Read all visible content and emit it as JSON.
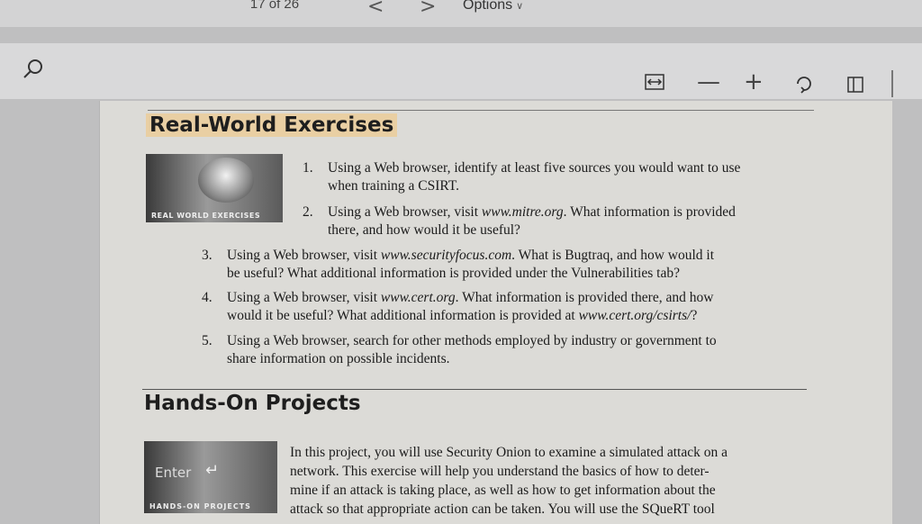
{
  "topbar": {
    "page_count": "17 of 26",
    "prev_glyph": "<",
    "next_glyph": ">",
    "options_label": "Options"
  },
  "toolbar": {
    "icons": [
      "search-icon",
      "fit-width-icon",
      "zoom-out-icon",
      "zoom-in-icon",
      "rotate-icon",
      "page-view-icon"
    ],
    "minus_glyph": "—",
    "plus_glyph": "+"
  },
  "document": {
    "section1_title": "Real-World Exercises",
    "thumb1_label": "REAL WORLD EXERCISES",
    "items": [
      {
        "num": "1.",
        "lines": [
          "Using a Web browser, identify at least five sources you would want to use",
          "when training a CSIRT."
        ]
      },
      {
        "num": "2.",
        "lines_pre": "Using a Web browser, visit ",
        "link": "www.mitre.org",
        "lines_post": ". What information is provided",
        "line2": "there, and how would it be useful?"
      },
      {
        "num": "3.",
        "lines_pre": "Using a Web browser, visit ",
        "link": "www.securityfocus.com",
        "lines_post": ". What is Bugtraq, and how would it",
        "line2": "be useful? What additional information is provided under the Vulnerabilities tab?"
      },
      {
        "num": "4.",
        "lines_pre": "Using a Web browser, visit ",
        "link": "www.cert.org",
        "lines_post": ". What information is provided there, and how",
        "line2_pre": "would it be useful? What additional information is provided at ",
        "line2_link": "www.cert.org/csirts/",
        "line2_post": "?"
      },
      {
        "num": "5.",
        "lines": [
          "Using a Web browser, search for other methods employed by industry or government to",
          "share information on possible incidents."
        ]
      }
    ],
    "section2_title": "Hands-On Projects",
    "thumb2_enter": "Enter",
    "thumb2_label": "HANDS-ON PROJECTS",
    "project_lines": [
      "In this project, you will use Security Onion to examine a simulated attack on a",
      "network. This exercise will help you understand the basics of how to deter-",
      "mine if an attack is taking place, as well as how to get information about the",
      "attack so that appropriate action can be taken. You will use the SQueRT tool"
    ]
  }
}
